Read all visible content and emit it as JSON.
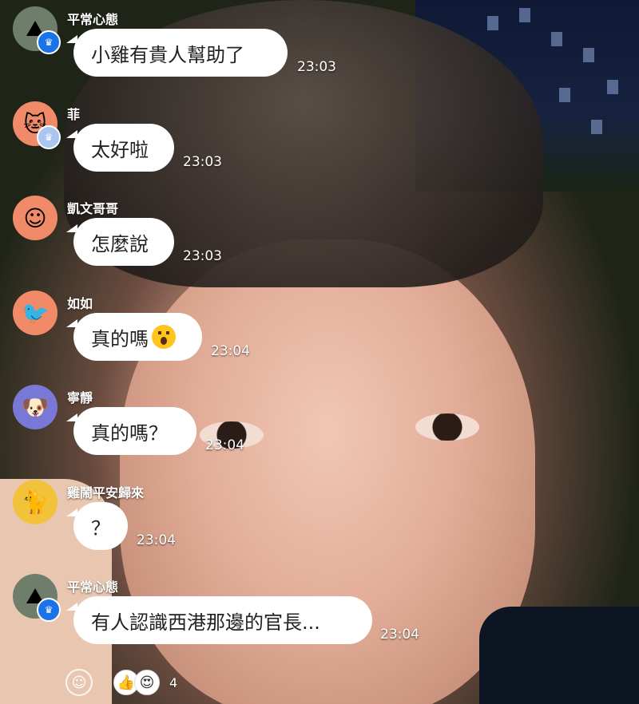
{
  "colors": {
    "bubble_bg": "#ffffff",
    "badge_blue": "#1a73e8",
    "badge_light": "#a9c5f0",
    "name_text": "#ffffff"
  },
  "messages": [
    {
      "name": "平常心態",
      "text": "小雞有貴人幫助了",
      "time": "23:03",
      "avatar_icon": "landscape-avatar-icon",
      "badge": "crown-badge"
    },
    {
      "name": "菲",
      "text": "太好啦",
      "time": "23:03",
      "avatar_icon": "cat-avatar-icon",
      "badge": "crown-badge-light"
    },
    {
      "name": "凱文哥哥",
      "text": "怎麼說",
      "time": "23:03",
      "avatar_icon": "man-avatar-icon"
    },
    {
      "name": "如如",
      "text": "真的嗎",
      "time": "23:04",
      "avatar_icon": "bird-avatar-icon",
      "emoji": "surprised-emoji-icon"
    },
    {
      "name": "寧靜",
      "text": "真的嗎？",
      "time": "23:04",
      "avatar_icon": "dog-avatar-icon"
    },
    {
      "name": "雞鬧平安歸來",
      "text": "？",
      "time": "23:04",
      "avatar_icon": "black-cat-avatar-icon"
    },
    {
      "name": "平常心態",
      "text": "有人認識西港那邊的官長...",
      "time": "23:04",
      "avatar_icon": "landscape-avatar-icon",
      "badge": "crown-badge"
    }
  ],
  "bottom_bar": {
    "reaction_count": "4",
    "emoji_button_icon": "smile-icon",
    "reaction_icons": [
      "thumbs-up-face-icon",
      "heart-eyes-face-icon"
    ]
  }
}
